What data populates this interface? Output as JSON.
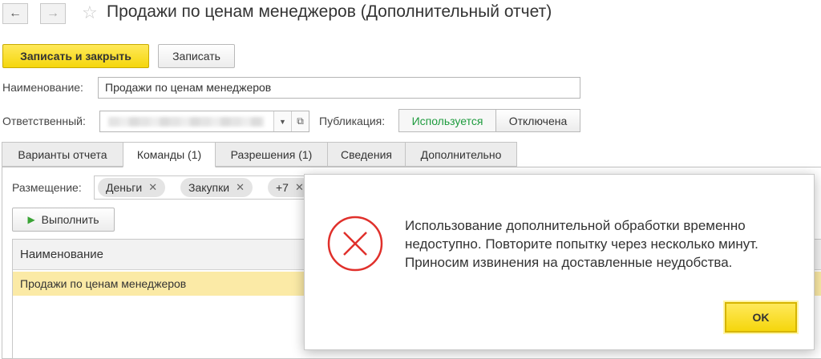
{
  "window": {
    "title": "Продажи по ценам менеджеров (Дополнительный отчет)",
    "back_icon": "←",
    "forward_icon": "→",
    "star_icon": "☆"
  },
  "toolbar": {
    "save_close_label": "Записать и закрыть",
    "save_label": "Записать"
  },
  "form": {
    "name_label": "Наименование:",
    "name_value": "Продажи по ценам менеджеров",
    "responsible_label": "Ответственный:",
    "responsible_dropdown_icon": "▼",
    "responsible_open_icon": "⧉",
    "publication_label": "Публикация:",
    "publication_used": "Используется",
    "publication_disabled": "Отключена"
  },
  "tabs": [
    {
      "label": "Варианты отчета"
    },
    {
      "label": "Команды (1)"
    },
    {
      "label": "Разрешения (1)"
    },
    {
      "label": "Сведения"
    },
    {
      "label": "Дополнительно"
    }
  ],
  "commands": {
    "placement_label": "Размещение:",
    "chips": [
      {
        "label": "Деньги",
        "remove": "✕"
      },
      {
        "label": "Закупки",
        "remove": "✕"
      },
      {
        "label": "+7",
        "remove": "✕"
      }
    ],
    "run_icon": "▶",
    "run_label": "Выполнить",
    "table": {
      "column_header": "Наименование",
      "rows": [
        {
          "name": "Продажи по ценам менеджеров"
        }
      ]
    }
  },
  "dialog": {
    "message": "Использование дополнительной обработки временно недоступно. Повторите попытку через несколько минут. Приносим извинения на доставленные неудобства.",
    "ok_label": "OK",
    "icon": "error-icon"
  },
  "colors": {
    "primary_button": "#f5d60c",
    "selected_row": "#fbeaa6",
    "publication_active": "#1e9b3e",
    "error_icon": "#e0302b"
  }
}
